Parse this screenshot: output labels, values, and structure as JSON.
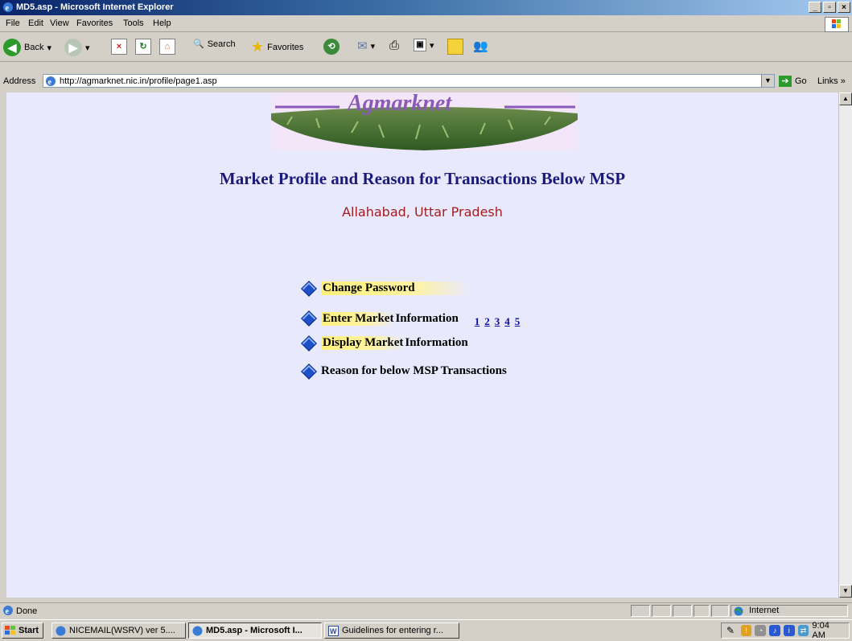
{
  "window": {
    "title": "MD5.asp - Microsoft Internet Explorer"
  },
  "menu": [
    "File",
    "Edit",
    "View",
    "Favorites",
    "Tools",
    "Help"
  ],
  "toolbar": {
    "back": "Back",
    "search": "Search",
    "favorites": "Favorites"
  },
  "address": {
    "label": "Address",
    "url": "http://agmarknet.nic.in/profile/page1.asp",
    "go": "Go",
    "links": "Links"
  },
  "page": {
    "logo_text": "Agmarknet",
    "heading": "Market Profile and Reason for Transactions Below MSP",
    "location": "Allahabad, Uttar Pradesh",
    "items": [
      {
        "highlight": "Change Password",
        "rest": ""
      },
      {
        "highlight": "Enter Market",
        "rest": " Information"
      },
      {
        "highlight": "Display Market",
        "rest": " Information"
      },
      {
        "highlight": "",
        "rest": "Reason for below MSP Transactions"
      }
    ],
    "pages": [
      "1",
      "2",
      "3",
      "4",
      "5"
    ]
  },
  "status": {
    "text": "Done",
    "zone": "Internet"
  },
  "taskbar": {
    "start": "Start",
    "tasks": [
      "NICEMAIL(WSRV) ver 5....",
      "MD5.asp - Microsoft I...",
      "Guidelines for entering r..."
    ],
    "clock": "9:04 AM"
  },
  "colors": {
    "content_bg": "#e9e9fd",
    "heading": "#1a1a7a",
    "location": "#a01e1e",
    "link": "#0a0aa0",
    "bullet": "#1e50c8"
  }
}
